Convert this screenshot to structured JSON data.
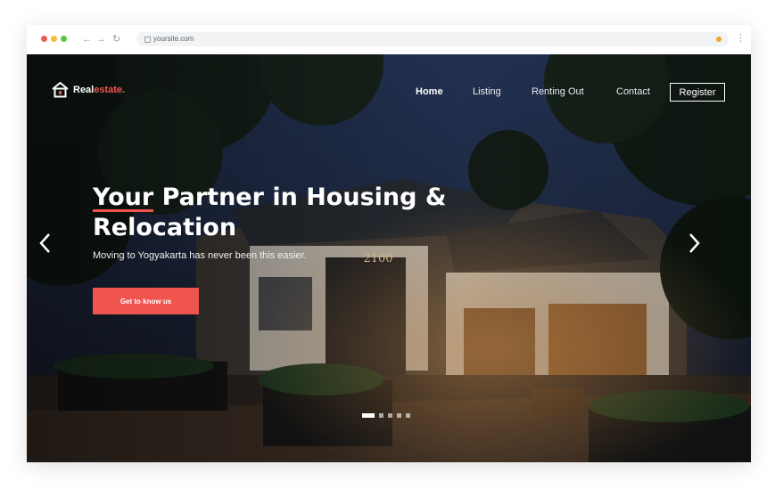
{
  "browser": {
    "url": "yoursite.com"
  },
  "site": {
    "logo_text": "Real",
    "logo_accent": "estate.",
    "nav": [
      {
        "label": "Home",
        "active": true
      },
      {
        "label": "Listing",
        "active": false
      },
      {
        "label": "Renting Out",
        "active": false
      },
      {
        "label": "Contact",
        "active": false
      }
    ],
    "register_label": "Register"
  },
  "hero": {
    "headline_highlight": "Your",
    "headline_line1_rest": " Partner in Housing &",
    "headline_line2": "Relocation",
    "subtext": "Moving to Yogyakarta has never been this easier.",
    "cta_label": "Get to know us",
    "building_sign": "2100",
    "slide_count": 5,
    "active_slide": 1
  },
  "colors": {
    "accent": "#f0544f",
    "sky": "#1b2333",
    "text": "#ffffff"
  }
}
